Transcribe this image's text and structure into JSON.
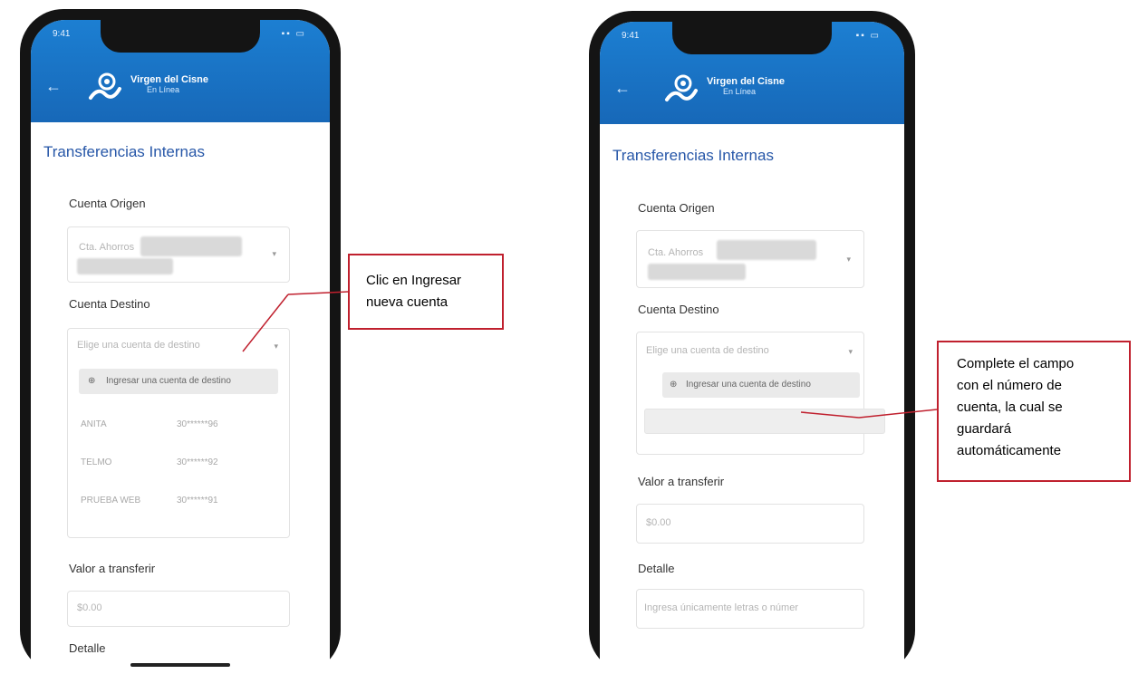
{
  "app": {
    "brand_name": "Virgen del Cisne",
    "brand_sub": "En Línea",
    "back_icon": "arrow-left-icon",
    "header_color": "#1c7fd2",
    "accent_color": "#2757a8",
    "callout_border_color": "#c0202e"
  },
  "left": {
    "page_title": "Transferencias Internas",
    "origin_label": "Cuenta Origen",
    "origin_value": "Cta. Ahorros",
    "dest_label": "Cuenta Destino",
    "dest_placeholder": "Elige una cuenta de destino",
    "new_account_option": "Ingresar una cuenta de destino",
    "accounts": [
      {
        "name": "ANITA",
        "number": "30******96"
      },
      {
        "name": "TELMO",
        "number": "30******92"
      },
      {
        "name": "PRUEBA WEB",
        "number": "30******91"
      }
    ],
    "amount_label": "Valor a transferir",
    "amount_placeholder": "$0.00",
    "detail_label": "Detalle"
  },
  "right": {
    "page_title": "Transferencias Internas",
    "origin_label": "Cuenta Origen",
    "origin_value": "Cta. Ahorros",
    "dest_label": "Cuenta Destino",
    "dest_placeholder": "Elige una cuenta de destino",
    "new_account_option": "Ingresar una cuenta de destino",
    "account_number_value": "",
    "amount_label": "Valor a transferir",
    "amount_placeholder": "$0.00",
    "detail_label": "Detalle",
    "detail_placeholder": "Ingresa únicamente letras o númer"
  },
  "callouts": {
    "left": [
      "Clic en Ingresar",
      "nueva cuenta"
    ],
    "right": [
      "Complete el campo",
      "con el número de",
      "cuenta, la cual se",
      "guardará",
      "automáticamente"
    ]
  }
}
